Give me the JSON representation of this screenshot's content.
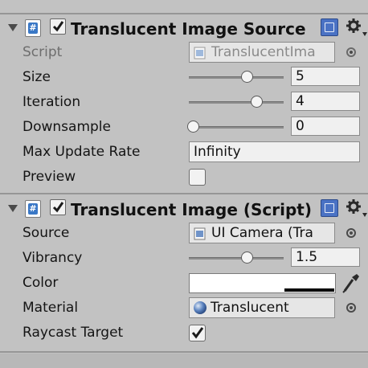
{
  "components": [
    {
      "title": "Translucent Image Source",
      "enabled": true,
      "fields": {
        "script": {
          "label": "Script",
          "value": "TranslucentIma"
        },
        "size": {
          "label": "Size",
          "value": "5",
          "slider_fraction": 0.62
        },
        "iteration": {
          "label": "Iteration",
          "value": "4",
          "slider_fraction": 0.72
        },
        "downsample": {
          "label": "Downsample",
          "value": "0",
          "slider_fraction": 0.0
        },
        "max_update_rate": {
          "label": "Max Update Rate",
          "value": "Infinity"
        },
        "preview": {
          "label": "Preview",
          "checked": false
        }
      }
    },
    {
      "title": "Translucent Image (Script)",
      "enabled": true,
      "fields": {
        "source": {
          "label": "Source",
          "value": "UI Camera (Tra"
        },
        "vibrancy": {
          "label": "Vibrancy",
          "value": "1.5",
          "slider_fraction": 0.62
        },
        "color": {
          "label": "Color",
          "value": "#ffffff"
        },
        "material": {
          "label": "Material",
          "value": "Translucent"
        },
        "raycast_target": {
          "label": "Raycast Target",
          "checked": true
        }
      }
    }
  ],
  "icons": {
    "foldout": "foldout-arrow-icon",
    "script": "csharp-script-icon",
    "help": "help-book-icon",
    "settings": "gear-icon",
    "picker": "object-picker-icon",
    "eyedropper": "eyedropper-icon",
    "material": "material-sphere-icon"
  },
  "colors": {
    "panel_background": "#c2c2c2",
    "field_background": "#f0f0f0",
    "accent_blue": "#3a78c6"
  }
}
